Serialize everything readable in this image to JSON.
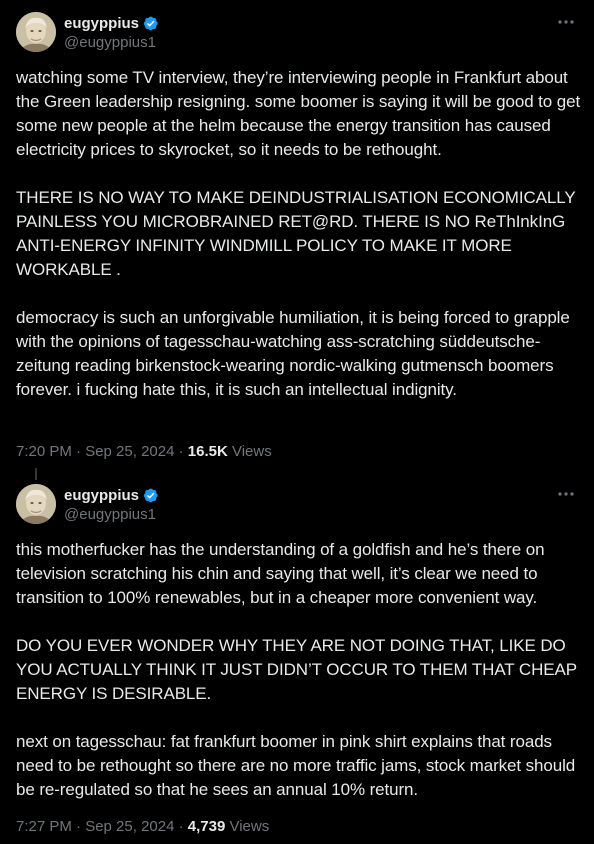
{
  "tweets": [
    {
      "display_name": "eugyppius",
      "handle": "@eugyppius1",
      "more_icon": "more-horizontal-icon",
      "verified_icon": "verified-badge-icon",
      "text": "watching some TV interview, they’re interviewing people in Frankfurt about the Green leadership resigning. some boomer is saying it will be good to get some new people at the helm because the energy transition has caused electricity prices to skyrocket, so it needs to be rethought.\n\nTHERE IS NO WAY TO MAKE DEINDUSTRIALISATION ECONOMICALLY PAINLESS YOU MICROBRAINED RET@RD. THERE IS NO ReThInkInG ANTI-ENERGY INFINITY WINDMILL POLICY TO MAKE IT MORE WORKABLE .\n\ndemocracy is such an unforgivable humiliation, it is being forced to grapple with the opinions of tagesschau-watching ass-scratching süddeutsche-zeitung reading birkenstock-wearing nordic-walking gutmensch boomers forever. i fucking hate this, it is such an intellectual indignity.",
      "timestamp": "7:20 PM · Sep 25, 2024 · ",
      "views_count": "16.5K",
      "views_label": " Views"
    },
    {
      "display_name": "eugyppius",
      "handle": "@eugyppius1",
      "more_icon": "more-horizontal-icon",
      "verified_icon": "verified-badge-icon",
      "text": "this motherfucker has the understanding of a goldfish and he’s there on television scratching his chin and saying that well, it’s clear we need to transition to 100% renewables, but in a cheaper more convenient way.\n\nDO YOU EVER WONDER WHY THEY ARE NOT DOING THAT, LIKE DO YOU ACTUALLY THINK IT JUST DIDN’T OCCUR TO THEM THAT CHEAP ENERGY IS DESIRABLE.\n\nnext on tagesschau: fat frankfurt boomer in pink shirt explains that roads need to be rethought so there are no more traffic jams, stock market should be re-regulated so that he sees an annual 10% return.",
      "timestamp": "7:27 PM · Sep 25, 2024 · ",
      "views_count": "4,739",
      "views_label": " Views"
    }
  ],
  "colors": {
    "background": "#000000",
    "text": "#e7e9ea",
    "secondary_text": "#71767b",
    "verified_blue": "#1d9bf0",
    "thread_line": "#333639"
  }
}
